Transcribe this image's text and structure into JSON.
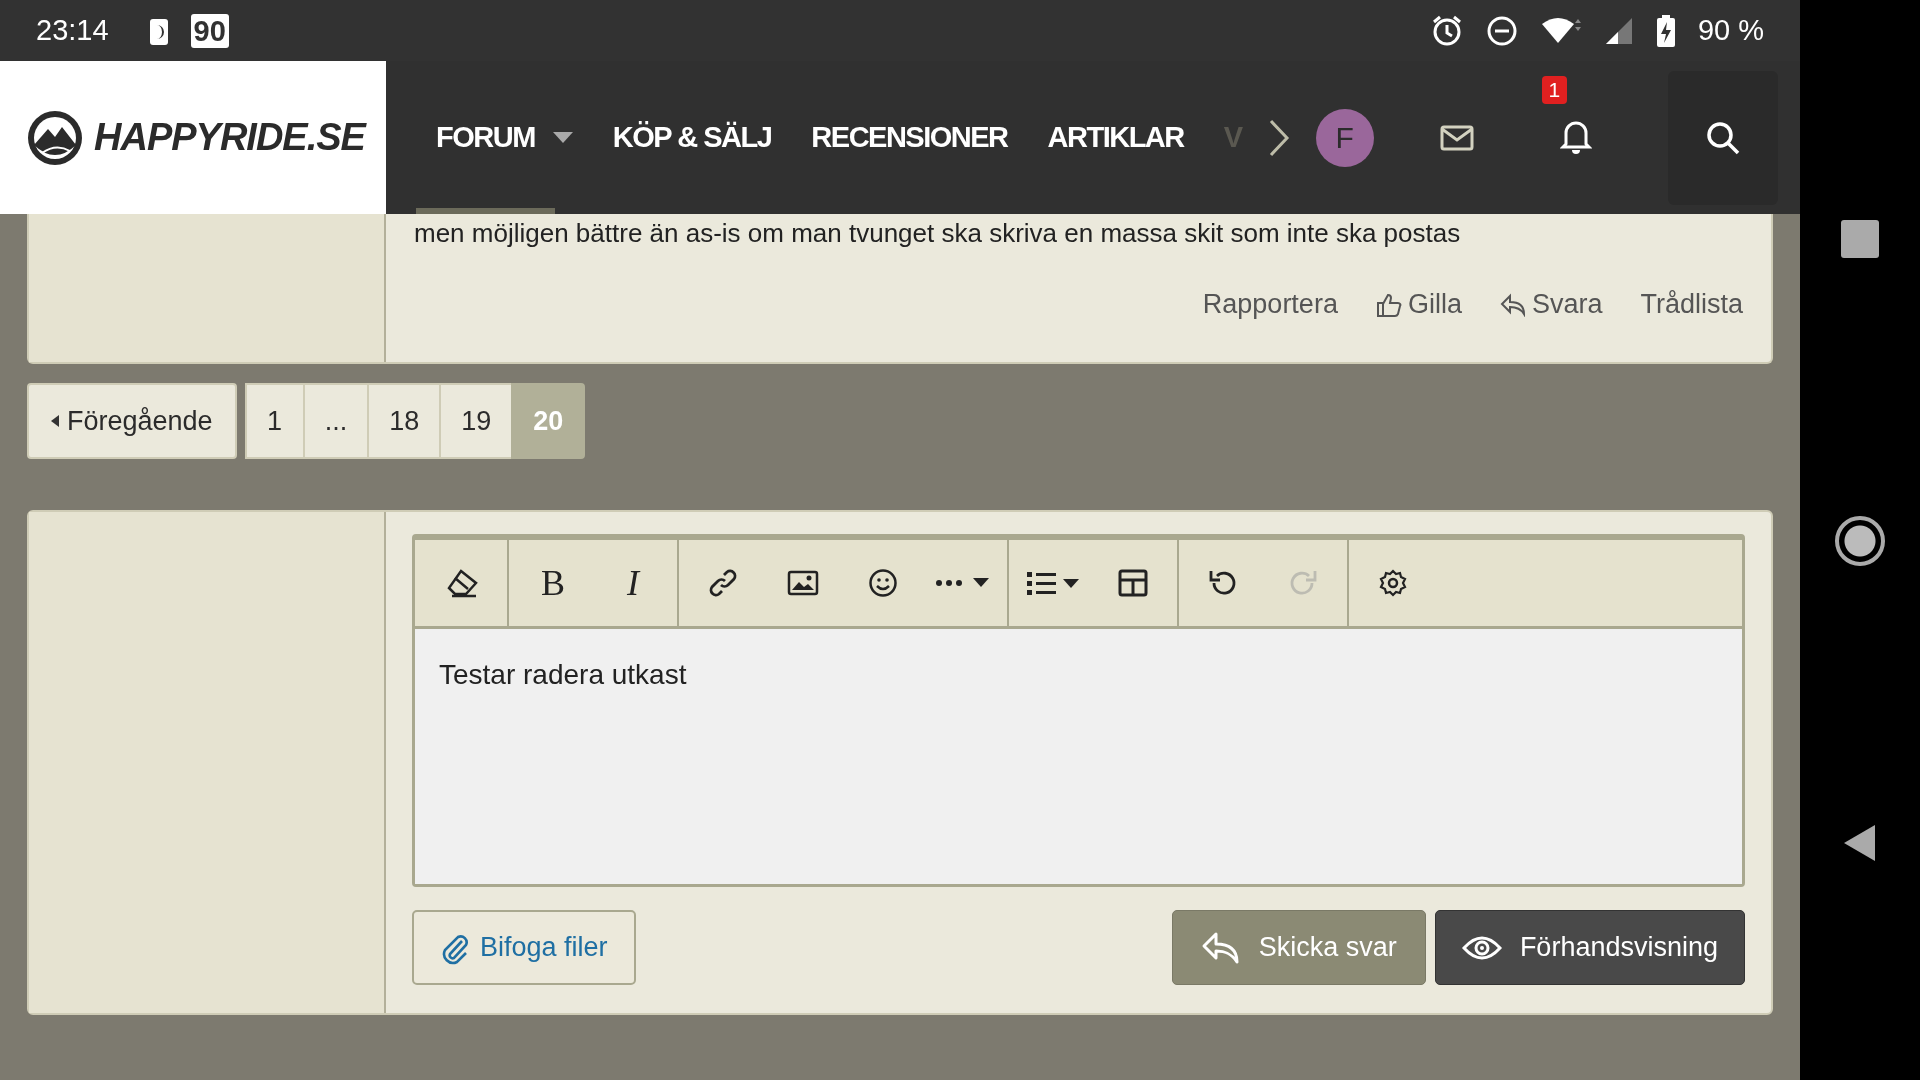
{
  "status_bar": {
    "time": "23:14",
    "notification_badge": "90",
    "battery": "90 %"
  },
  "header": {
    "logo": "HAPPYRIDE.SE",
    "nav": [
      {
        "label": "FORUM",
        "selected": true,
        "dropdown": true
      },
      {
        "label": "KÖP & SÄLJ",
        "selected": false,
        "dropdown": false
      },
      {
        "label": "RECENSIONER",
        "selected": false,
        "dropdown": false
      },
      {
        "label": "ARTIKLAR",
        "selected": false,
        "dropdown": false
      },
      {
        "label": "V",
        "selected": false,
        "dropdown": false,
        "faded": true
      }
    ],
    "avatar": "F",
    "alerts_badge": "1"
  },
  "post": {
    "text": "men möjligen bättre än as-is om man tvunget ska skriva en massa skit som inte ska postas",
    "actions": [
      {
        "kind": "report",
        "label": "Rapportera"
      },
      {
        "kind": "like",
        "label": "Gilla"
      },
      {
        "kind": "reply",
        "label": "Svara"
      },
      {
        "kind": "thread",
        "label": "Trådlista"
      }
    ]
  },
  "pagination": {
    "previous": "Föregående",
    "pages": [
      {
        "label": "1",
        "selected": false
      },
      {
        "label": "...",
        "selected": false
      },
      {
        "label": "18",
        "selected": false
      },
      {
        "label": "19",
        "selected": false
      },
      {
        "label": "20",
        "selected": true
      }
    ]
  },
  "editor": {
    "toolbar": [
      {
        "kind": "eraser",
        "disabled": false
      },
      {
        "kind": "separator"
      },
      {
        "kind": "bold",
        "label": "B",
        "disabled": false
      },
      {
        "kind": "italic",
        "label": "I",
        "disabled": false
      },
      {
        "kind": "separator"
      },
      {
        "kind": "link",
        "disabled": false
      },
      {
        "kind": "image",
        "disabled": false
      },
      {
        "kind": "smiley",
        "disabled": false
      },
      {
        "kind": "more",
        "disabled": false
      },
      {
        "kind": "separator"
      },
      {
        "kind": "list",
        "disabled": false
      },
      {
        "kind": "table",
        "disabled": false
      },
      {
        "kind": "separator"
      },
      {
        "kind": "undo",
        "disabled": false
      },
      {
        "kind": "redo",
        "disabled": true
      },
      {
        "kind": "separator"
      },
      {
        "kind": "settings",
        "disabled": false
      }
    ],
    "value": "Testar radera utkast",
    "attach": "Bifoga filer",
    "submit": "Skicka svar",
    "preview": "Förhandsvisning"
  }
}
